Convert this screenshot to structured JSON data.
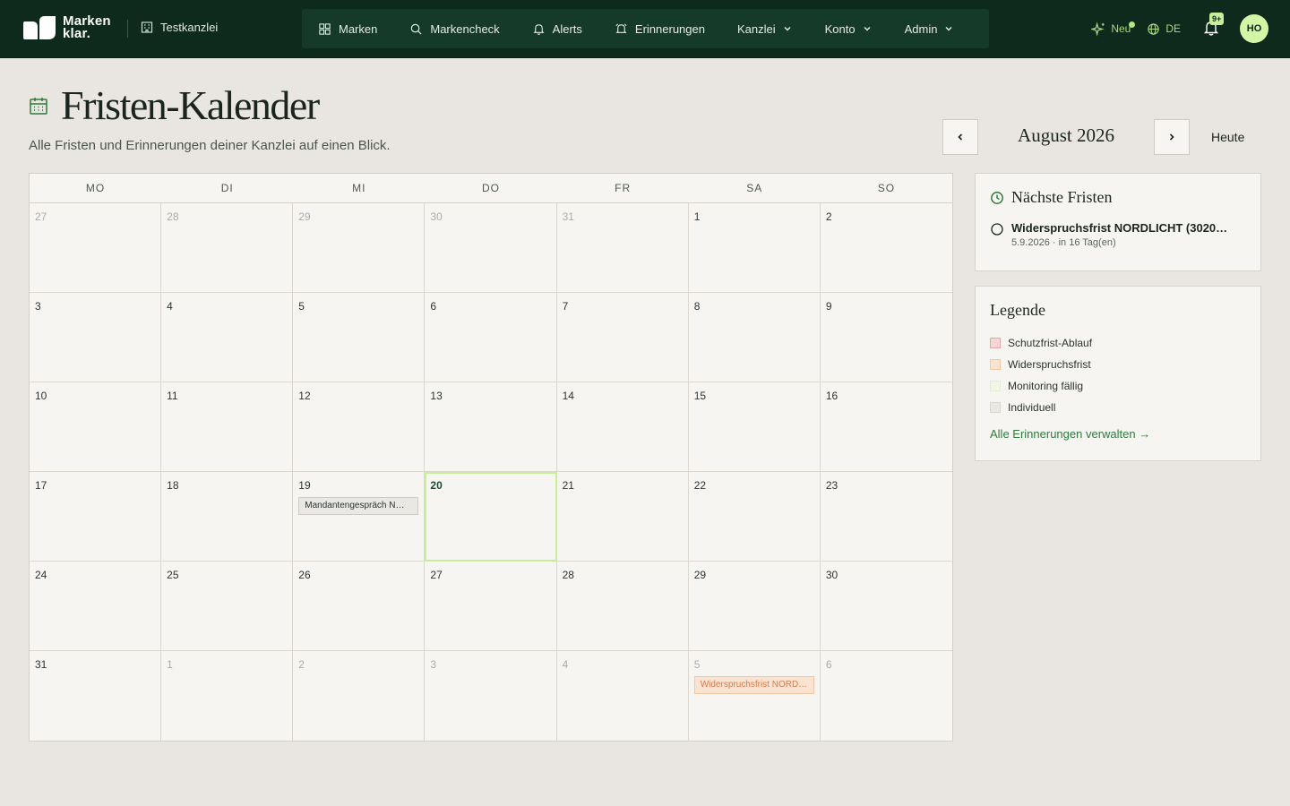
{
  "brand": {
    "line1": "Marken",
    "line2": "klar."
  },
  "firm": {
    "name": "Testkanzlei"
  },
  "nav": {
    "items": [
      {
        "label": "Marken",
        "icon": "grid-icon",
        "dropdown": false
      },
      {
        "label": "Markencheck",
        "icon": "search-icon",
        "dropdown": false
      },
      {
        "label": "Alerts",
        "icon": "bell-icon",
        "dropdown": false
      },
      {
        "label": "Erinnerungen",
        "icon": "alarm-icon",
        "dropdown": false
      },
      {
        "label": "Kanzlei",
        "dropdown": true
      },
      {
        "label": "Konto",
        "dropdown": true
      },
      {
        "label": "Admin",
        "dropdown": true
      }
    ],
    "news_label": "Neu",
    "lang_label": "DE",
    "notif_count": "9+",
    "avatar_initials": "HO"
  },
  "page": {
    "title": "Fristen-Kalender",
    "subtitle": "Alle Fristen und Erinnerungen deiner Kanzlei auf einen Blick.",
    "month_label": "August 2026",
    "today_label": "Heute"
  },
  "calendar": {
    "weekdays": [
      "MO",
      "DI",
      "MI",
      "DO",
      "FR",
      "SA",
      "SO"
    ],
    "days": [
      {
        "num": "27",
        "out": true
      },
      {
        "num": "28",
        "out": true
      },
      {
        "num": "29",
        "out": true
      },
      {
        "num": "30",
        "out": true
      },
      {
        "num": "31",
        "out": true
      },
      {
        "num": "1",
        "out": false
      },
      {
        "num": "2",
        "out": false
      },
      {
        "num": "3"
      },
      {
        "num": "4"
      },
      {
        "num": "5"
      },
      {
        "num": "6"
      },
      {
        "num": "7"
      },
      {
        "num": "8"
      },
      {
        "num": "9"
      },
      {
        "num": "10"
      },
      {
        "num": "11"
      },
      {
        "num": "12"
      },
      {
        "num": "13"
      },
      {
        "num": "14"
      },
      {
        "num": "15"
      },
      {
        "num": "16"
      },
      {
        "num": "17"
      },
      {
        "num": "18"
      },
      {
        "num": "19",
        "events": [
          {
            "label": "Mandantengespräch N…",
            "type": "individual"
          }
        ]
      },
      {
        "num": "20",
        "today": true
      },
      {
        "num": "21"
      },
      {
        "num": "22"
      },
      {
        "num": "23"
      },
      {
        "num": "24"
      },
      {
        "num": "25"
      },
      {
        "num": "26"
      },
      {
        "num": "27"
      },
      {
        "num": "28"
      },
      {
        "num": "29"
      },
      {
        "num": "30"
      },
      {
        "num": "31"
      },
      {
        "num": "1",
        "out": true
      },
      {
        "num": "2",
        "out": true
      },
      {
        "num": "3",
        "out": true
      },
      {
        "num": "4",
        "out": true
      },
      {
        "num": "5",
        "out": true,
        "events": [
          {
            "label": "Widerspruchsfrist NORD…",
            "type": "opposition"
          }
        ]
      },
      {
        "num": "6",
        "out": true
      }
    ]
  },
  "upcoming": {
    "title": "Nächste Fristen",
    "items": [
      {
        "name": "Widerspruchsfrist NORDLICHT (3020…",
        "meta": "5.9.2026 · in 16 Tag(en)"
      }
    ]
  },
  "legend": {
    "title": "Legende",
    "items": [
      {
        "label": "Schutzfrist-Ablauf",
        "bg": "#f7d6d6",
        "border": "#e8a5a5"
      },
      {
        "label": "Widerspruchsfrist",
        "bg": "#fbe3d2",
        "border": "#f3c6a6"
      },
      {
        "label": "Monitoring fällig",
        "bg": "#eef8e4",
        "border": "#e1f0d3"
      },
      {
        "label": "Individuell",
        "bg": "#e9e8e4",
        "border": "#d9d6d0"
      }
    ],
    "manage_link": "Alle Erinnerungen verwalten →"
  },
  "colors": {
    "topbar": "#0d2a1d",
    "accent": "#c6ef96",
    "link": "#2f7a3c"
  }
}
